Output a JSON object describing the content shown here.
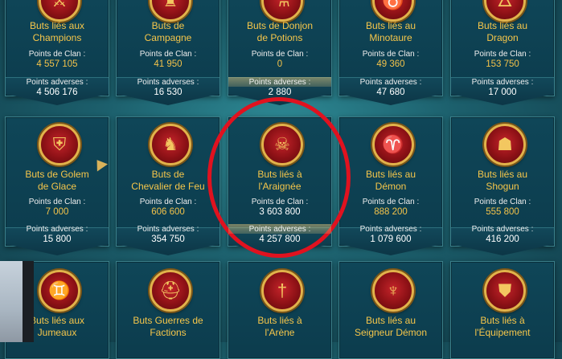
{
  "labels": {
    "clan": "Points de Clan :",
    "adverse": "Points adverses :"
  },
  "colors": {
    "title": "#f6c64a",
    "marker": "#e0121f",
    "card_bg": "#0f4658"
  },
  "row1": [
    {
      "name": "champions",
      "line1": "Buts liés aux",
      "line2": "Champions",
      "clan": "4 557 105",
      "adverse": "4 506 176",
      "icon": "crossed-swords-icon"
    },
    {
      "name": "campagne",
      "line1": "Buts de",
      "line2": "Campagne",
      "clan": "41 950",
      "adverse": "16 530",
      "icon": "castle-icon"
    },
    {
      "name": "donjon-potions",
      "line1": "Buts de Donjon",
      "line2": "de Potions",
      "clan": "0",
      "adverse": "2 880",
      "icon": "potion-icon"
    },
    {
      "name": "minotaure",
      "line1": "Buts liés au",
      "line2": "Minotaure",
      "clan": "49 360",
      "adverse": "47 680",
      "icon": "minotaur-icon"
    },
    {
      "name": "dragon",
      "line1": "Buts liés au",
      "line2": "Dragon",
      "clan": "153 750",
      "adverse": "17 000",
      "icon": "dragon-icon"
    }
  ],
  "row2": [
    {
      "name": "golem-glace",
      "line1": "Buts de Golem",
      "line2": "de Glace",
      "clan": "7 000",
      "adverse": "15 800",
      "icon": "golem-icon"
    },
    {
      "name": "chevalier-feu",
      "line1": "Buts de",
      "line2": "Chevalier de Feu",
      "clan": "606 600",
      "adverse": "354 750",
      "icon": "fire-knight-icon"
    },
    {
      "name": "araignee",
      "line1": "Buts liés à",
      "line2": "l'Araignée",
      "clan": "3 603 800",
      "adverse": "4 257 800",
      "icon": "spider-icon"
    },
    {
      "name": "demon",
      "line1": "Buts liés au",
      "line2": "Démon",
      "clan": "888 200",
      "adverse": "1 079 600",
      "icon": "demon-icon"
    },
    {
      "name": "shogun",
      "line1": "Buts liés au",
      "line2": "Shogun",
      "clan": "555 800",
      "adverse": "416 200",
      "icon": "shogun-icon"
    }
  ],
  "row3": [
    {
      "name": "jumeaux",
      "line1": "Buts liés aux",
      "line2": "Jumeaux",
      "icon": "twins-icon"
    },
    {
      "name": "guerres-factions",
      "line1": "Buts Guerres de",
      "line2": "Factions",
      "icon": "helmet-icon"
    },
    {
      "name": "arene",
      "line1": "Buts liés à",
      "line2": "l'Arène",
      "icon": "arena-sword-icon"
    },
    {
      "name": "seigneur-demon",
      "line1": "Buts liés au",
      "line2": "Seigneur Démon",
      "icon": "demon-lord-icon"
    },
    {
      "name": "equipement",
      "line1": "Buts liés à",
      "line2": "l'Équipement",
      "icon": "armor-icon"
    }
  ]
}
